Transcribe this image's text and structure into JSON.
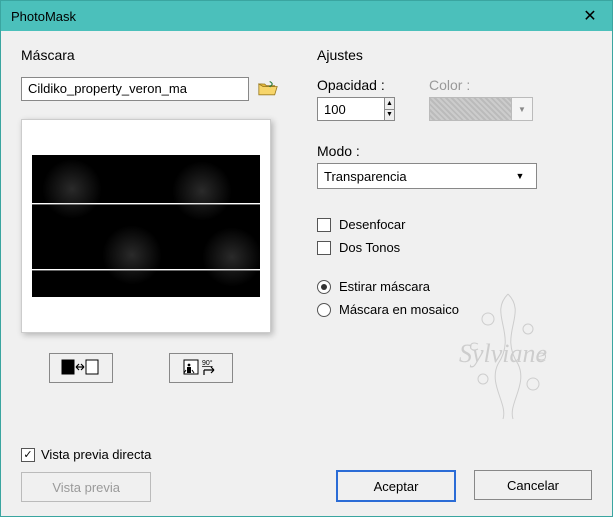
{
  "window": {
    "title": "PhotoMask"
  },
  "mask": {
    "group_label": "Máscara",
    "path_value": "Cildiko_property_veron_ma"
  },
  "adjust": {
    "group_label": "Ajustes",
    "opacity_label": "Opacidad :",
    "opacity_value": "100",
    "color_label": "Color :",
    "mode_label": "Modo :",
    "mode_value": "Transparencia",
    "blur_label": "Desenfocar",
    "duotone_label": "Dos Tonos",
    "stretch_label": "Estirar máscara",
    "mosaic_label": "Máscara en mosaico"
  },
  "footer": {
    "direct_preview_label": "Vista previa directa",
    "preview_btn": "Vista previa",
    "ok_btn": "Aceptar",
    "cancel_btn": "Cancelar"
  },
  "watermark_text": "Sylviane"
}
